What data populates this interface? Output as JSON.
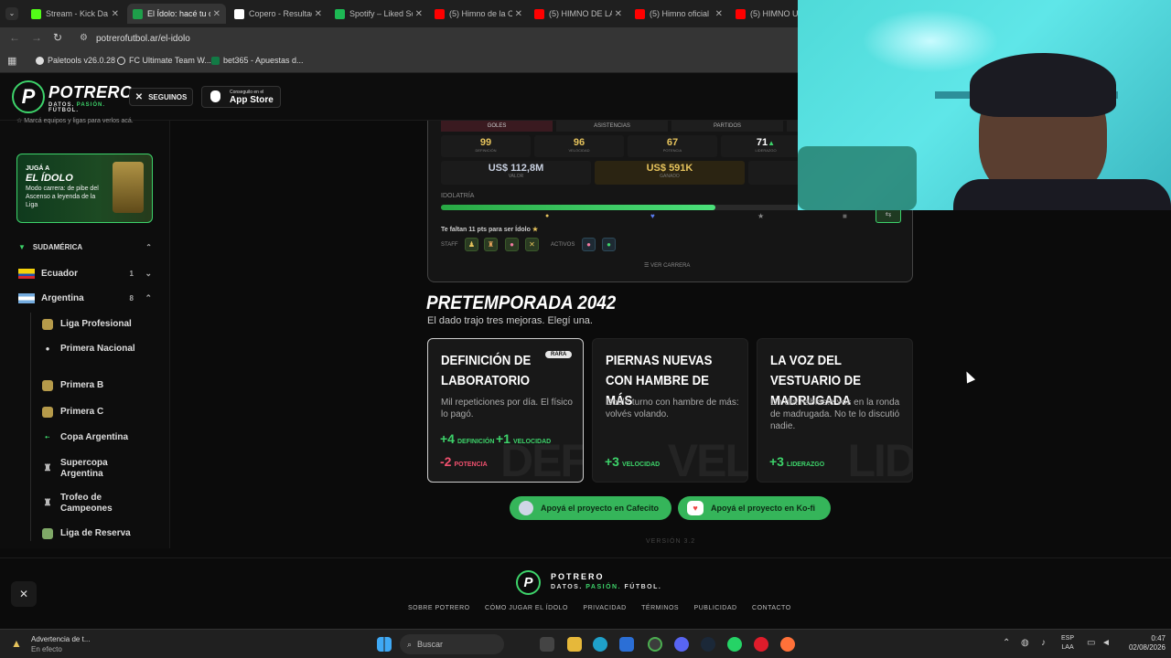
{
  "browser": {
    "tabs": [
      {
        "label": "Stream - Kick Da",
        "color": "#53fc18"
      },
      {
        "label": "El Ídolo: hacé tu c",
        "color": "#1e9f4a"
      },
      {
        "label": "Copero - Resultad",
        "color": "#ffffff"
      },
      {
        "label": "Spotify – Liked So",
        "color": "#1db954"
      },
      {
        "label": "(5) Himno de la C",
        "color": "#ff0000"
      },
      {
        "label": "(5) HIMNO DE LA",
        "color": "#ff0000"
      },
      {
        "label": "(5) Himno oficial",
        "color": "#ff0000"
      },
      {
        "label": "(5) HIMNO UEF",
        "color": "#ff0000"
      }
    ],
    "url": "potrerofutbol.ar/el-idolo",
    "bookmarks": [
      "Paletools v26.0.28",
      "FC Ultimate Team W...",
      "bet365 - Apuestas d..."
    ]
  },
  "header": {
    "brand": "POTRERO",
    "tagline_1": "DATOS.",
    "tagline_2": "PASIÓN.",
    "tagline_3": "FÚTBOL.",
    "follow_label": "SEGUINOS",
    "appstore_small": "Conseguilo en el",
    "appstore_big": "App Store"
  },
  "sidebar": {
    "hint": "Marcá equipos y ligas para verlos acá.",
    "promo_line1": "JUGÁ A",
    "promo_line2": "EL ÍDOLO",
    "promo_desc": "Modo carrera: de pibe del Ascenso a leyenda de la Liga",
    "region": "SUDAMÉRICA",
    "countries": [
      {
        "name": "Ecuador",
        "count": "1"
      },
      {
        "name": "Argentina",
        "count": "8"
      }
    ],
    "leagues": [
      "Liga Profesional",
      "Primera Nacional",
      "Primera B",
      "Primera C",
      "Copa Argentina",
      "Supercopa Argentina",
      "Trofeo de Campeones",
      "Liga de Reserva"
    ]
  },
  "career": {
    "headers": [
      "GOLES",
      "ASISTENCIAS",
      "PARTIDOS"
    ],
    "stats": [
      {
        "value": "99",
        "label": "DEFINICIÓN"
      },
      {
        "value": "96",
        "label": "VELOCIDAD"
      },
      {
        "value": "67",
        "label": "POTENCIA"
      },
      {
        "value": "71",
        "label": "LIDERAZGO"
      }
    ],
    "value_amount": "US$ 112,8M",
    "value_label": "VALOR",
    "earned_amount": "US$ 591K",
    "earned_label": "GANADO",
    "idolatry_label": "IDOLATRÍA",
    "idolatry_progress": 0.6,
    "remaining": "Te faltan 11 pts para ser Ídolo",
    "staff_label": "STAFF",
    "active_label": "ACTIVOS",
    "view_career": "VER CARRERA"
  },
  "preseason": {
    "title": "PRETEMPORADA 2042",
    "subtitle": "El dado trajo tres mejoras. Elegí una.",
    "cards": [
      {
        "title": "Definición de laboratorio",
        "badge": "RARA",
        "desc": "Mil repeticiones por día. El físico lo pagó.",
        "watermark": "DEF",
        "b1n": "+4",
        "b1k": "DEFINICIÓN",
        "b2n": "+1",
        "b2k": "VELOCIDAD",
        "b3n": "-2",
        "b3k": "POTENCIA"
      },
      {
        "title": "Piernas nuevas con hambre de más",
        "desc": "Doble turno con hambre de más: volvés volando.",
        "watermark": "VEL",
        "b1n": "+3",
        "b1k": "VELOCIDAD"
      },
      {
        "title": "La voz del vestuario de madrugada",
        "desc": "Un día hablaste vos en la ronda de madrugada. No te lo discutió nadie.",
        "watermark": "LID",
        "b1n": "+3",
        "b1k": "LIDERAZGO"
      }
    ]
  },
  "support": {
    "cafecito": "Apoyá el proyecto en Cafecito",
    "kofi": "Apoyá el proyecto en Ko-fi"
  },
  "footer": {
    "version": "VERSIÓN 3.2",
    "brand": "POTRERO",
    "tagline_1": "DATOS.",
    "tagline_2": "PASIÓN.",
    "tagline_3": "FÚTBOL.",
    "links": [
      "SOBRE POTRERO",
      "CÓMO JUGAR EL ÍDOLO",
      "PRIVACIDAD",
      "TÉRMINOS",
      "PUBLICIDAD",
      "CONTACTO"
    ]
  },
  "taskbar": {
    "notif_title": "Advertencia de t...",
    "notif_sub": "En efecto",
    "search": "Buscar",
    "lang1": "ESP",
    "lang2": "LAA",
    "time": "0:47",
    "date": "02/08/2026"
  },
  "colors": {
    "accent": "#35b55a",
    "gold": "#e6c35c",
    "negative": "#f0506e"
  }
}
